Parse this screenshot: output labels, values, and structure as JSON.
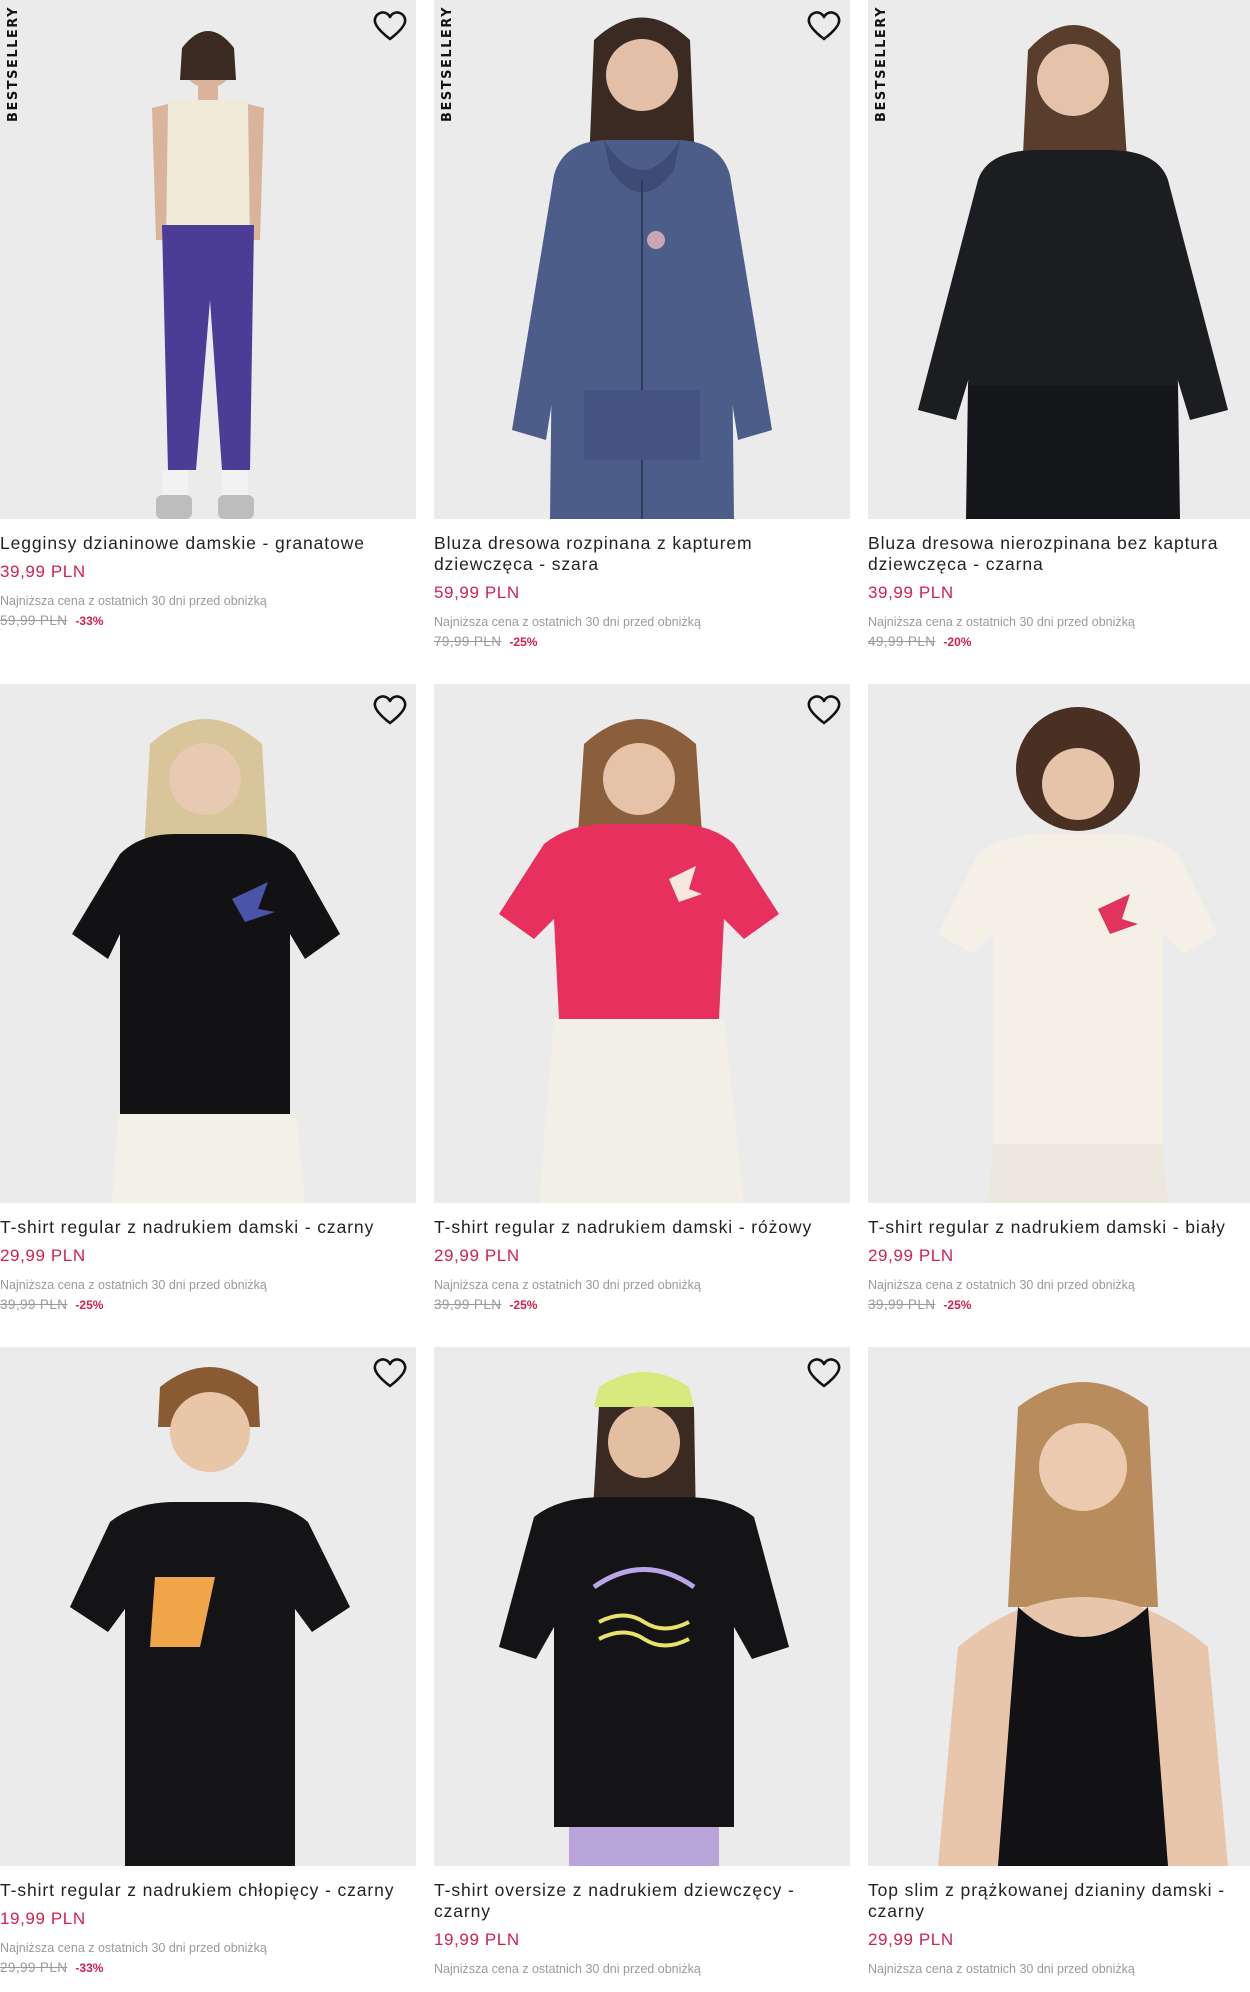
{
  "colors": {
    "price": "#d0214f",
    "discount": "#d0214f",
    "muted": "#9a9a9a",
    "photo_bg": "#ebebeb"
  },
  "icons": {
    "favorite": "heart-outline-icon"
  },
  "products": [
    {
      "badge": "BESTSELLERY",
      "name": "Legginsy dzianinowe damskie - granatowe",
      "price": "39,99 PLN",
      "lowest_label": "Najniższa cena z ostatnich 30 dni przed obniżką",
      "old_price": "59,99 PLN",
      "discount": "-33%"
    },
    {
      "badge": "BESTSELLERY",
      "name": "Bluza dresowa rozpinana z kapturem dziewczęca - szara",
      "price": "59,99 PLN",
      "lowest_label": "Najniższa cena z ostatnich 30 dni przed obniżką",
      "old_price": "79,99 PLN",
      "discount": "-25%"
    },
    {
      "badge": "BESTSELLERY",
      "name": "Bluza dresowa nierozpinana bez kaptura dziewczęca - czarna",
      "price": "39,99 PLN",
      "lowest_label": "Najniższa cena z ostatnich 30 dni przed obniżką",
      "old_price": "49,99 PLN",
      "discount": "-20%"
    },
    {
      "badge": "",
      "name": "T-shirt regular z nadrukiem damski - czarny",
      "price": "29,99 PLN",
      "lowest_label": "Najniższa cena z ostatnich 30 dni przed obniżką",
      "old_price": "39,99 PLN",
      "discount": "-25%"
    },
    {
      "badge": "",
      "name": "T-shirt regular z nadrukiem damski - różowy",
      "price": "29,99 PLN",
      "lowest_label": "Najniższa cena z ostatnich 30 dni przed obniżką",
      "old_price": "39,99 PLN",
      "discount": "-25%"
    },
    {
      "badge": "",
      "name": "T-shirt regular z nadrukiem damski - biały",
      "price": "29,99 PLN",
      "lowest_label": "Najniższa cena z ostatnich 30 dni przed obniżką",
      "old_price": "39,99 PLN",
      "discount": "-25%"
    },
    {
      "badge": "",
      "name": "T-shirt regular z nadrukiem chłopięcy - czarny",
      "price": "19,99 PLN",
      "lowest_label": "Najniższa cena z ostatnich 30 dni przed obniżką",
      "old_price": "29,99 PLN",
      "discount": "-33%"
    },
    {
      "badge": "",
      "name": "T-shirt oversize z nadrukiem dziewczęcy - czarny",
      "price": "19,99 PLN",
      "lowest_label": "Najniższa cena z ostatnich 30 dni przed obniżką",
      "old_price": "",
      "discount": ""
    },
    {
      "badge": "",
      "name": "Top slim z prążkowanej dzianiny damski - czarny",
      "price": "29,99 PLN",
      "lowest_label": "Najniższa cena z ostatnich 30 dni przed obniżką",
      "old_price": "",
      "discount": ""
    }
  ]
}
